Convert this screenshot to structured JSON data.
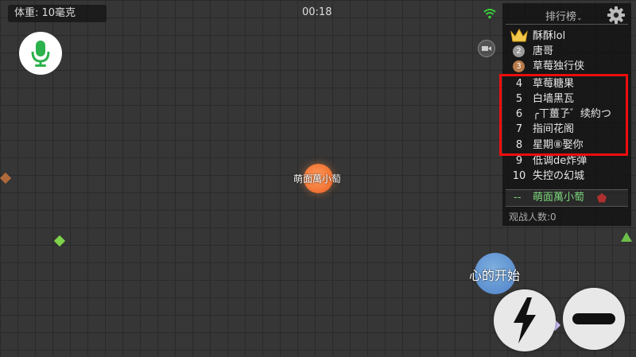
{
  "hud": {
    "weight": "体重: 10毫克",
    "timer": "00:18"
  },
  "leaderboard": {
    "title": "排行榜",
    "rows": [
      {
        "rank": "",
        "name": "酥酥lol"
      },
      {
        "rank": "2",
        "name": "唐哥"
      },
      {
        "rank": "3",
        "name": "草莓独行侠"
      },
      {
        "rank": "4",
        "name": "草莓糖果"
      },
      {
        "rank": "5",
        "name": "白墙黑瓦"
      },
      {
        "rank": "6",
        "name": "╭丅薑孒゛续約つ"
      },
      {
        "rank": "7",
        "name": "指间花阁"
      },
      {
        "rank": "8",
        "name": "星期⑧娶你"
      },
      {
        "rank": "9",
        "name": "低调de炸弹"
      },
      {
        "rank": "10",
        "name": "失控の幻城"
      }
    ],
    "self_rank": "--",
    "self_name": "萌面萬小萄",
    "spectators": "观战人数:0"
  },
  "player": {
    "name": "萌面萬小萄"
  },
  "opponent": {
    "name": "心的开始"
  },
  "colors": {
    "accent": "#7bd67b",
    "highlight": "#ee0d0d",
    "mic": "#2bb24c"
  },
  "icons": [
    "crown-icon",
    "mic-icon",
    "wifi-icon",
    "camera-icon",
    "gear-icon",
    "lightning-icon",
    "split-icon",
    "pentagon-icon"
  ]
}
